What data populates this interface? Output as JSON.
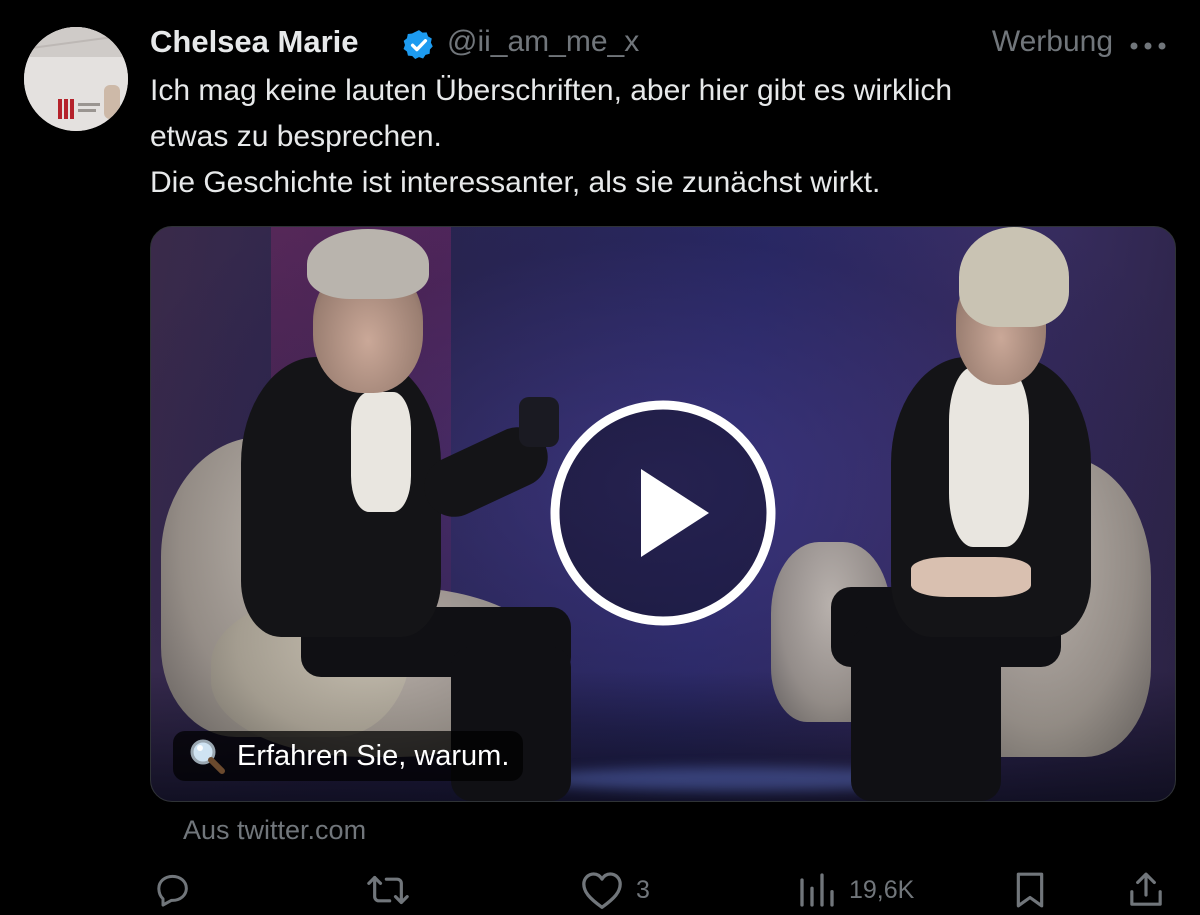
{
  "tweet": {
    "author": {
      "display_name": "Chelsea Marie",
      "handle": "@ii_am_me_x",
      "verified": true
    },
    "ad_label": "Werbung",
    "text_lines": [
      "Ich mag keine lauten Überschriften, aber hier gibt es wirklich",
      "etwas zu besprechen.",
      "Die Geschichte ist interessanter, als sie zunächst wirkt."
    ],
    "media": {
      "type": "video",
      "caption": "Erfahren Sie, warum.",
      "caption_icon": "magnifying-glass-icon",
      "play_icon": "play-icon"
    },
    "source": "Aus twitter.com",
    "actions": {
      "reply": {
        "icon": "reply-icon",
        "count": ""
      },
      "repost": {
        "icon": "repost-icon",
        "count": ""
      },
      "like": {
        "icon": "heart-icon",
        "count": "3"
      },
      "views": {
        "icon": "views-icon",
        "count": "19,6K"
      },
      "bookmark": {
        "icon": "bookmark-icon",
        "count": ""
      },
      "share": {
        "icon": "share-icon",
        "count": ""
      }
    }
  },
  "colors": {
    "background": "#000000",
    "primary_text": "#e7e9ea",
    "secondary_text": "#71767b",
    "verified_blue": "#1d9bf0"
  }
}
